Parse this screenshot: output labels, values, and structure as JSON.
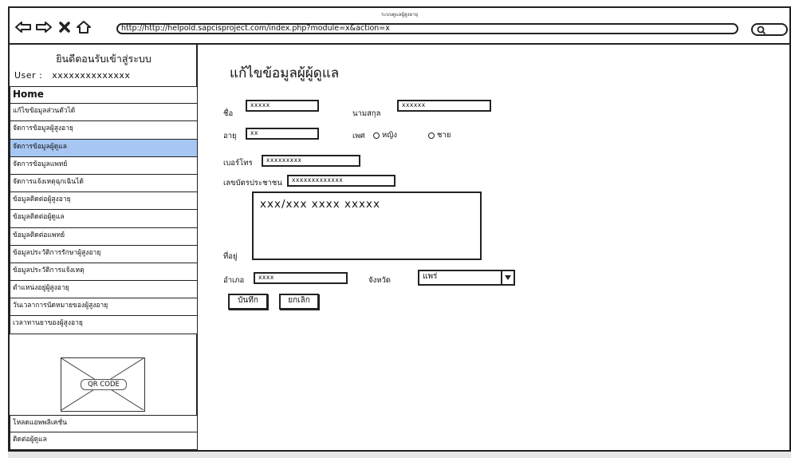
{
  "window": {
    "title": "ระบบดูแลผู้สูงอายุ",
    "url": "http://http://helpold.sapcisproject.com/index.php?module=x&action=x"
  },
  "icons": {
    "back": "arrow-left-icon",
    "forward": "arrow-right-icon",
    "stop": "close-icon",
    "home": "home-icon",
    "search": "search-icon"
  },
  "sidebar": {
    "welcome": "ยินดีตอนรับเข้าสู่ระบบ",
    "user_label": "User :",
    "user_value": "xxxxxxxxxxxxxx",
    "menu": [
      {
        "label": "Home"
      },
      {
        "label": "แก้ไขข้อมูลส่วนตัวได้"
      },
      {
        "label": "จัดการข้อมูลผู้สูงอายุ"
      },
      {
        "label": "จัดการข้อมูลผู้ดูแล",
        "active": true
      },
      {
        "label": "จัดการข้อมูลแพทย์"
      },
      {
        "label": "จัดการแจ้งเหตุฉุกเฉินได้"
      },
      {
        "label": "ข้อมูลติดต่อผู้สูงอายุ"
      },
      {
        "label": "ข้อมูลติดต่อผู้ดูแล"
      },
      {
        "label": "ข้อมูลติดต่อแพทย์"
      },
      {
        "label": "ข้อมูลประวัติการรักษาผู้สูงอายุ"
      },
      {
        "label": "ข้อมูลประวัติการแจ้งเหตุ"
      },
      {
        "label": "ตำแหน่งอยู่ผู้สูงอายุ"
      },
      {
        "label": "วันเวลาการนัดหมายของผู้สูงอายุ"
      },
      {
        "label": "เวลาทานยาของผู้สูงอายุ"
      }
    ],
    "qr_label": "QR CODE",
    "bottom": [
      {
        "label": "โหลดแอพพลิเคชั่น"
      },
      {
        "label": "ติดต่อผู้ดูแล"
      }
    ]
  },
  "form": {
    "title": "แก้ไขข้อมูลผู้ผู้ดูแล",
    "first_name_label": "ชื่อ",
    "first_name_value": "xxxxx",
    "last_name_label": "นามสกุล",
    "last_name_value": "xxxxxx",
    "age_label": "อายุ",
    "age_value": "xx",
    "sex_label": "เพศ",
    "sex_female": "หญิง",
    "sex_male": "ชาย",
    "phone_label": "เบอร์โทร",
    "phone_value": "xxxxxxxxx",
    "id_label": "เลขบัตรประชาชน",
    "id_value": "xxxxxxxxxxxxx",
    "address_label": "ที่อยู่",
    "address_value": "xxx/xxx xxxx xxxxx",
    "district_label": "อำเภอ",
    "district_value": "xxxx",
    "province_label": "จังหวัด",
    "province_value": "แพร่",
    "save_label": "บันทึก",
    "cancel_label": "ยกเลิก"
  }
}
